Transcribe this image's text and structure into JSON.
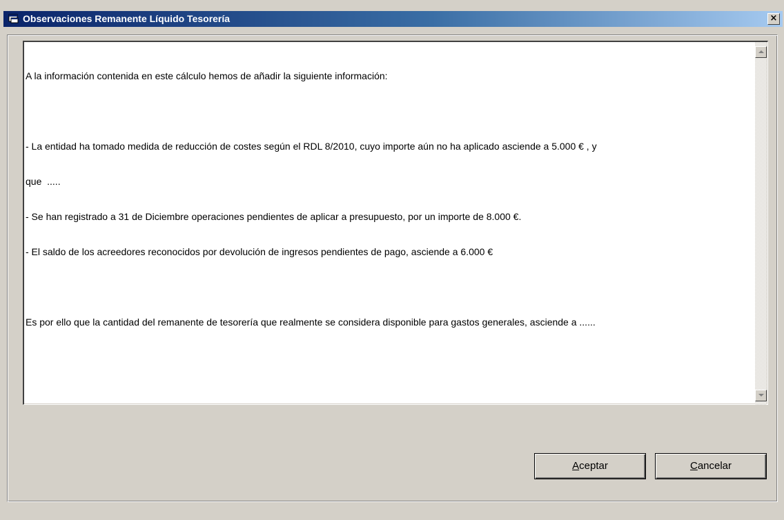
{
  "window": {
    "title": "Observaciones Remanente Líquido Tesorería",
    "close_label": "×"
  },
  "text": {
    "lines": [
      "A la información contenida en este cálculo hemos de añadir la siguiente información:",
      "",
      "- La entidad ha tomado medida de reducción de costes según el RDL 8/2010, cuyo importe aún no ha aplicado asciende a 5.000 € , y",
      "que  .....",
      "- Se han registrado a 31 de Diciembre operaciones pendientes de aplicar a presupuesto, por un importe de 8.000 €.",
      "- El saldo de los acreedores reconocidos por devolución de ingresos pendientes de pago, asciende a 6.000 €",
      "",
      "Es por ello que la cantidad del remanente de tesorería que realmente se considera disponible para gastos generales, asciende a ......"
    ]
  },
  "buttons": {
    "accept_hotkey": "A",
    "accept_rest": "ceptar",
    "cancel_hotkey": "C",
    "cancel_rest": "ancelar"
  },
  "colors": {
    "titlebar_start": "#0a246a",
    "titlebar_end": "#a6caf0",
    "face": "#d4d0c8"
  },
  "icons": {
    "title": "window-app-icon",
    "close": "close-icon",
    "scroll_up": "scroll-up-arrow-icon",
    "scroll_down": "scroll-down-arrow-icon"
  }
}
